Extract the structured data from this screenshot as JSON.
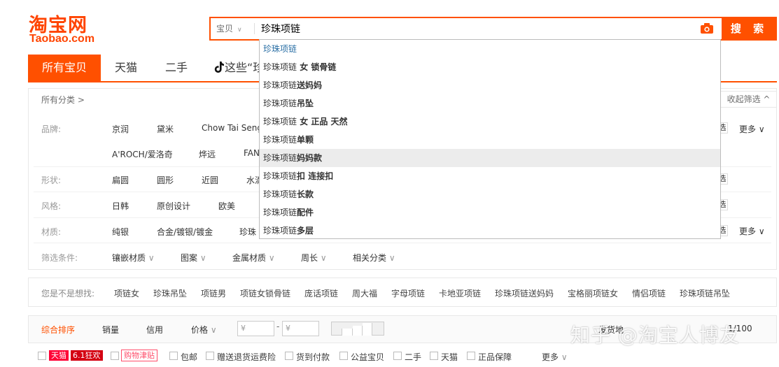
{
  "logo": {
    "cn": "淘宝网",
    "en": "Taobao.com"
  },
  "search": {
    "type_label": "宝贝",
    "query": "珍珠项链",
    "button_label": "搜 索"
  },
  "suggestions": [
    {
      "prefix": "珍珠项链",
      "suffix": ""
    },
    {
      "prefix": "珍珠项链",
      "suffix": " 女 锁骨链"
    },
    {
      "prefix": "珍珠项链",
      "suffix": "送妈妈"
    },
    {
      "prefix": "珍珠项链",
      "suffix": "吊坠"
    },
    {
      "prefix": "珍珠项链",
      "suffix": " 女 正品 天然"
    },
    {
      "prefix": "珍珠项链",
      "suffix": "单颗"
    },
    {
      "prefix": "珍珠项链",
      "suffix": "妈妈款"
    },
    {
      "prefix": "珍珠项链",
      "suffix": "扣 连接扣"
    },
    {
      "prefix": "珍珠项链",
      "suffix": "长款"
    },
    {
      "prefix": "珍珠项链",
      "suffix": "配件"
    },
    {
      "prefix": "珍珠项链",
      "suffix": "多层"
    }
  ],
  "tabs": {
    "all": "所有宝贝",
    "tmall": "天猫",
    "secondhand": "二手",
    "tiktok": "这些“珍"
  },
  "filters": {
    "all_categories": "所有分类 >",
    "collapse": "收起筛选 ^",
    "rows": {
      "brand": {
        "label": "品牌:",
        "values": [
          "京润",
          "黛米",
          "Chow Tai Seng",
          "A'ROCH/爱洛奇",
          "烨远",
          "FAN"
        ],
        "more": "更多",
        "select": "选"
      },
      "shape": {
        "label": "形状:",
        "values": [
          "扁圆",
          "圆形",
          "近圆",
          "水滴"
        ],
        "select": "选"
      },
      "style": {
        "label": "风格:",
        "values": [
          "日韩",
          "原创设计",
          "欧美"
        ],
        "select": "选"
      },
      "material": {
        "label": "材质:",
        "values": [
          "纯银",
          "合金/镀银/镀金",
          "珍珠"
        ],
        "more": "更多",
        "select": "选"
      }
    },
    "conditions": {
      "label": "筛选条件:",
      "values": [
        "镶嵌材质",
        "图案",
        "金属材质",
        "周长",
        "相关分类"
      ]
    }
  },
  "maybe": {
    "label": "您是不是想找:",
    "items": [
      "项链女",
      "珍珠吊坠",
      "项链男",
      "项链女锁骨链",
      "庞话项链",
      "周大福",
      "字母项链",
      "卡地亚项链",
      "珍珠项链送妈妈",
      "宝格丽项链女",
      "情侣项链",
      "珍珠项链吊坠"
    ]
  },
  "sortbar": {
    "items": [
      "综合排序",
      "销量",
      "信用",
      "价格"
    ],
    "price_min_placeholder": "¥",
    "price_max_placeholder": "¥",
    "dash": "-",
    "ship_from": "发货地",
    "pager": "1/100"
  },
  "checks": {
    "tmall_badge": "天猫",
    "promo_badge": "6.1狂欢",
    "gouwu_badge": "购物津贴",
    "items": [
      "包邮",
      "赠送退货运费险",
      "货到付款",
      "公益宝贝",
      "二手",
      "天猫",
      "正品保障"
    ],
    "more": "更多"
  },
  "watermark": "知乎 @淘宝人博友",
  "colors": {
    "accent": "#ff5000",
    "link": "#2a6fa5"
  }
}
